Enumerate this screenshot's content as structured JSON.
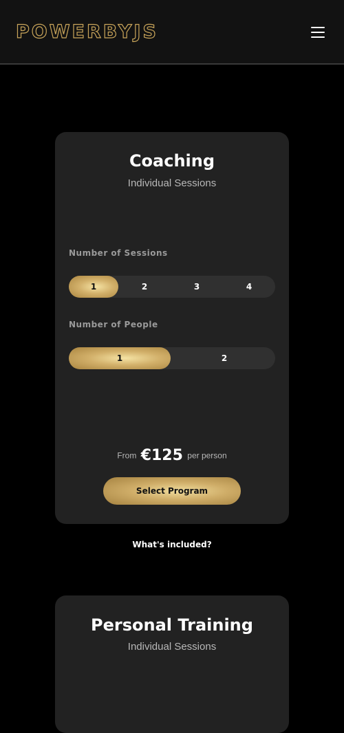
{
  "header": {
    "logo": "POWERBYJS",
    "menu_icon": "hamburger-menu-icon"
  },
  "colors": {
    "background": "#000000",
    "header": "#121212",
    "card": "#222222",
    "gold": "#d2b06a",
    "segment_track": "#303030"
  },
  "cards": [
    {
      "title": "Coaching",
      "subtitle": "Individual Sessions",
      "sessions_label": "Number of Sessions",
      "sessions_options": [
        "1",
        "2",
        "3",
        "4"
      ],
      "sessions_selected": "1",
      "people_label": "Number of People",
      "people_options": [
        "1",
        "2"
      ],
      "people_selected": "1",
      "price_prefix": "From",
      "price": "€125",
      "price_suffix": "per person",
      "select_label": "Select Program"
    },
    {
      "title": "Personal Training",
      "subtitle": "Individual Sessions"
    }
  ],
  "included_link": "What's included?"
}
